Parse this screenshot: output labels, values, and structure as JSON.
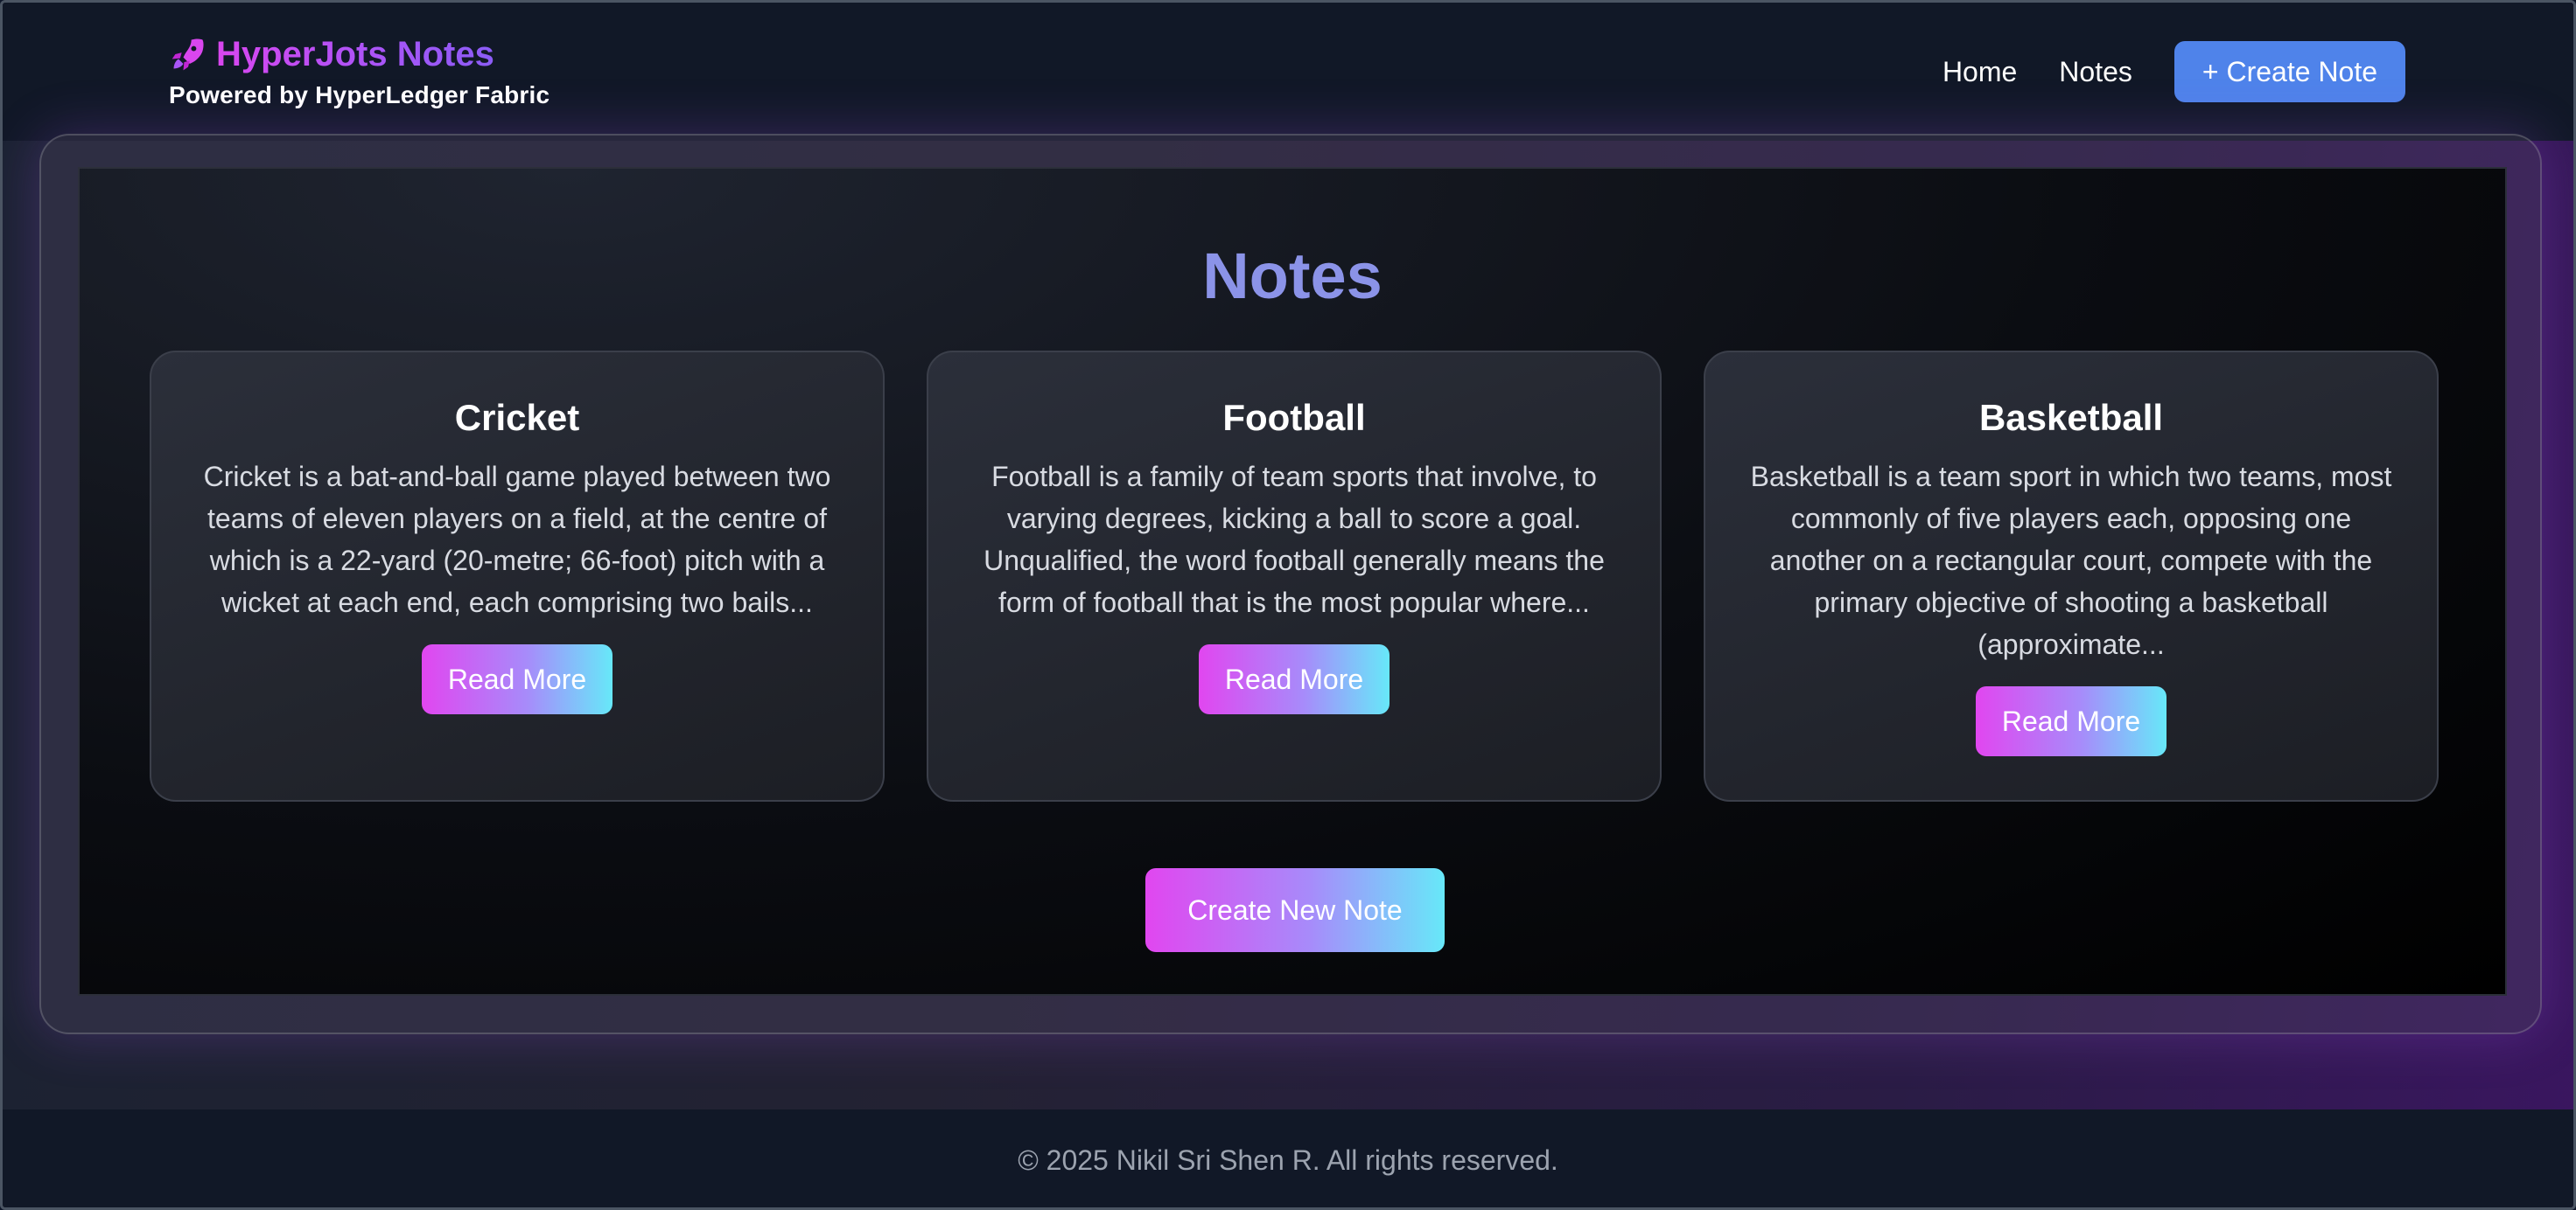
{
  "header": {
    "brand_title": "HyperJots Notes",
    "brand_subtitle": "Powered by HyperLedger Fabric",
    "brand_icon": "rocket-icon",
    "nav": [
      {
        "label": "Home"
      },
      {
        "label": "Notes"
      }
    ],
    "create_label": "+ Create Note"
  },
  "main": {
    "title": "Notes",
    "cards": [
      {
        "title": "Cricket",
        "text": "Cricket is a bat-and-ball game played between two teams of eleven players on a field, at the centre of which is a 22-yard (20-metre; 66-foot) pitch with a wicket at each end, each comprising two bails...",
        "button": "Read More"
      },
      {
        "title": "Football",
        "text": "Football is a family of team sports that involve, to varying degrees, kicking a ball to score a goal. Unqualified, the word football generally means the form of football that is the most popular where...",
        "button": "Read More"
      },
      {
        "title": "Basketball",
        "text": "Basketball is a team sport in which two teams, most commonly of five players each, opposing one another on a rectangular court, compete with the primary objective of shooting a basketball (approximate...",
        "button": "Read More"
      }
    ],
    "create_new_label": "Create New Note"
  },
  "footer": {
    "text": "© 2025 Nikil Sri Shen R. All rights reserved."
  },
  "colors": {
    "accent_blue": "#4f83ea",
    "brand_gradient_start": "#d946ef",
    "title_color": "#8b93e8",
    "button_gradient": [
      "#e146f0",
      "#a78bfa",
      "#67e8f9"
    ]
  }
}
